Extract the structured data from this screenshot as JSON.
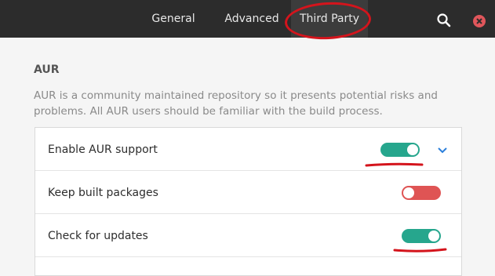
{
  "header": {
    "tabs": [
      {
        "label": "General",
        "active": false
      },
      {
        "label": "Advanced",
        "active": false
      },
      {
        "label": "Third Party",
        "active": true
      }
    ],
    "icons": {
      "search": "search-icon",
      "close": "close-icon"
    },
    "close_color": "#e0565b"
  },
  "section": {
    "title": "AUR",
    "description": "AUR is a community maintained repository so it presents potential risks and problems. All AUR users should be familiar with the build process."
  },
  "settings": [
    {
      "label": "Enable AUR support",
      "enabled": true,
      "expandable": true
    },
    {
      "label": "Keep built packages",
      "enabled": false
    },
    {
      "label": "Check for updates",
      "enabled": true
    }
  ],
  "colors": {
    "switch_on": "#26a68d",
    "switch_off": "#df5454",
    "accent": "#2a7fdb",
    "annotation": "#d4141c"
  }
}
